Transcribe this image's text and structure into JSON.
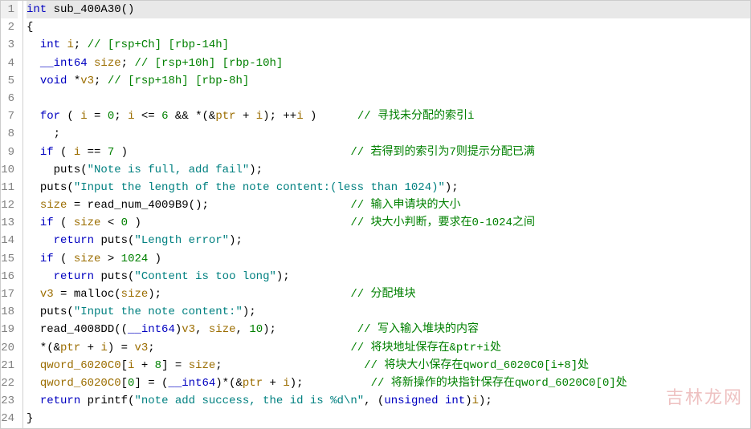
{
  "watermark": "吉林龙网",
  "lines": [
    {
      "n": 1,
      "current": true,
      "tokens": [
        [
          "type",
          "int"
        ],
        [
          "op",
          " "
        ],
        [
          "id-func",
          "sub_400A30"
        ],
        [
          "op",
          "()"
        ]
      ]
    },
    {
      "n": 2,
      "tokens": [
        [
          "braces",
          "{"
        ]
      ]
    },
    {
      "n": 3,
      "tokens": [
        [
          "op",
          "  "
        ],
        [
          "type",
          "int"
        ],
        [
          "op",
          " "
        ],
        [
          "var",
          "i"
        ],
        [
          "op",
          "; "
        ],
        [
          "c",
          "// [rsp+Ch] [rbp-14h]"
        ]
      ]
    },
    {
      "n": 4,
      "tokens": [
        [
          "op",
          "  "
        ],
        [
          "type",
          "__int64"
        ],
        [
          "op",
          " "
        ],
        [
          "var",
          "size"
        ],
        [
          "op",
          "; "
        ],
        [
          "c",
          "// [rsp+10h] [rbp-10h]"
        ]
      ]
    },
    {
      "n": 5,
      "tokens": [
        [
          "op",
          "  "
        ],
        [
          "type",
          "void"
        ],
        [
          "op",
          " *"
        ],
        [
          "var",
          "v3"
        ],
        [
          "op",
          "; "
        ],
        [
          "c",
          "// [rsp+18h] [rbp-8h]"
        ]
      ]
    },
    {
      "n": 6,
      "tokens": [
        [
          "op",
          " "
        ]
      ]
    },
    {
      "n": 7,
      "tokens": [
        [
          "op",
          "  "
        ],
        [
          "kw",
          "for"
        ],
        [
          "op",
          " ( "
        ],
        [
          "var",
          "i"
        ],
        [
          "op",
          " = "
        ],
        [
          "num",
          "0"
        ],
        [
          "op",
          "; "
        ],
        [
          "var",
          "i"
        ],
        [
          "op",
          " <= "
        ],
        [
          "num",
          "6"
        ],
        [
          "op",
          " && *(&"
        ],
        [
          "var",
          "ptr"
        ],
        [
          "op",
          " + "
        ],
        [
          "var",
          "i"
        ],
        [
          "op",
          "); ++"
        ],
        [
          "var",
          "i"
        ],
        [
          "op",
          " )      "
        ],
        [
          "c",
          "// 寻找未分配的索引i"
        ]
      ]
    },
    {
      "n": 8,
      "tokens": [
        [
          "op",
          "    ;"
        ]
      ]
    },
    {
      "n": 9,
      "tokens": [
        [
          "op",
          "  "
        ],
        [
          "kw",
          "if"
        ],
        [
          "op",
          " ( "
        ],
        [
          "var",
          "i"
        ],
        [
          "op",
          " == "
        ],
        [
          "num",
          "7"
        ],
        [
          "op",
          " )                                 "
        ],
        [
          "c",
          "// 若得到的索引为7则提示分配已满"
        ]
      ]
    },
    {
      "n": 10,
      "tokens": [
        [
          "op",
          "    "
        ],
        [
          "id-func",
          "puts"
        ],
        [
          "op",
          "("
        ],
        [
          "s",
          "\"Note is full, add fail\""
        ],
        [
          "op",
          ");"
        ]
      ]
    },
    {
      "n": 11,
      "tokens": [
        [
          "op",
          "  "
        ],
        [
          "id-func",
          "puts"
        ],
        [
          "op",
          "("
        ],
        [
          "s",
          "\"Input the length of the note content:(less than 1024)\""
        ],
        [
          "op",
          ");"
        ]
      ]
    },
    {
      "n": 12,
      "tokens": [
        [
          "op",
          "  "
        ],
        [
          "var",
          "size"
        ],
        [
          "op",
          " = "
        ],
        [
          "id-func",
          "read_num_4009B9"
        ],
        [
          "op",
          "();                     "
        ],
        [
          "c",
          "// 输入申请块的大小"
        ]
      ]
    },
    {
      "n": 13,
      "tokens": [
        [
          "op",
          "  "
        ],
        [
          "kw",
          "if"
        ],
        [
          "op",
          " ( "
        ],
        [
          "var",
          "size"
        ],
        [
          "op",
          " < "
        ],
        [
          "num",
          "0"
        ],
        [
          "op",
          " )                               "
        ],
        [
          "c",
          "// 块大小判断，要求在0-1024之间"
        ]
      ]
    },
    {
      "n": 14,
      "tokens": [
        [
          "op",
          "    "
        ],
        [
          "kw",
          "return"
        ],
        [
          "op",
          " "
        ],
        [
          "id-func",
          "puts"
        ],
        [
          "op",
          "("
        ],
        [
          "s",
          "\"Length error\""
        ],
        [
          "op",
          ");"
        ]
      ]
    },
    {
      "n": 15,
      "tokens": [
        [
          "op",
          "  "
        ],
        [
          "kw",
          "if"
        ],
        [
          "op",
          " ( "
        ],
        [
          "var",
          "size"
        ],
        [
          "op",
          " > "
        ],
        [
          "num",
          "1024"
        ],
        [
          "op",
          " )"
        ]
      ]
    },
    {
      "n": 16,
      "tokens": [
        [
          "op",
          "    "
        ],
        [
          "kw",
          "return"
        ],
        [
          "op",
          " "
        ],
        [
          "id-func",
          "puts"
        ],
        [
          "op",
          "("
        ],
        [
          "s",
          "\"Content is too long\""
        ],
        [
          "op",
          ");"
        ]
      ]
    },
    {
      "n": 17,
      "tokens": [
        [
          "op",
          "  "
        ],
        [
          "var",
          "v3"
        ],
        [
          "op",
          " = "
        ],
        [
          "id-func",
          "malloc"
        ],
        [
          "op",
          "("
        ],
        [
          "var",
          "size"
        ],
        [
          "op",
          ");                            "
        ],
        [
          "c",
          "// 分配堆块"
        ]
      ]
    },
    {
      "n": 18,
      "tokens": [
        [
          "op",
          "  "
        ],
        [
          "id-func",
          "puts"
        ],
        [
          "op",
          "("
        ],
        [
          "s",
          "\"Input the note content:\""
        ],
        [
          "op",
          ");"
        ]
      ]
    },
    {
      "n": 19,
      "tokens": [
        [
          "op",
          "  "
        ],
        [
          "id-func",
          "read_4008DD"
        ],
        [
          "op",
          "(("
        ],
        [
          "type",
          "__int64"
        ],
        [
          "op",
          ")"
        ],
        [
          "var",
          "v3"
        ],
        [
          "op",
          ", "
        ],
        [
          "var",
          "size"
        ],
        [
          "op",
          ", "
        ],
        [
          "num",
          "10"
        ],
        [
          "op",
          ");            "
        ],
        [
          "c",
          "// 写入输入堆块的内容"
        ]
      ]
    },
    {
      "n": 20,
      "tokens": [
        [
          "op",
          "  *(&"
        ],
        [
          "var",
          "ptr"
        ],
        [
          "op",
          " + "
        ],
        [
          "var",
          "i"
        ],
        [
          "op",
          ") = "
        ],
        [
          "var",
          "v3"
        ],
        [
          "op",
          ";                             "
        ],
        [
          "c",
          "// 将块地址保存在&ptr+i处"
        ]
      ]
    },
    {
      "n": 21,
      "tokens": [
        [
          "op",
          "  "
        ],
        [
          "var",
          "qword_6020C0"
        ],
        [
          "op",
          "["
        ],
        [
          "var",
          "i"
        ],
        [
          "op",
          " + "
        ],
        [
          "num",
          "8"
        ],
        [
          "op",
          "] = "
        ],
        [
          "var",
          "size"
        ],
        [
          "op",
          ";                     "
        ],
        [
          "c",
          "// 将块大小保存在qword_6020C0[i+8]处"
        ]
      ]
    },
    {
      "n": 22,
      "tokens": [
        [
          "op",
          "  "
        ],
        [
          "var",
          "qword_6020C0"
        ],
        [
          "op",
          "["
        ],
        [
          "num",
          "0"
        ],
        [
          "op",
          "] = ("
        ],
        [
          "type",
          "__int64"
        ],
        [
          "op",
          ")*(&"
        ],
        [
          "var",
          "ptr"
        ],
        [
          "op",
          " + "
        ],
        [
          "var",
          "i"
        ],
        [
          "op",
          ");          "
        ],
        [
          "c",
          "// 将新操作的块指针保存在qword_6020C0[0]处"
        ]
      ]
    },
    {
      "n": 23,
      "tokens": [
        [
          "op",
          "  "
        ],
        [
          "kw",
          "return"
        ],
        [
          "op",
          " "
        ],
        [
          "id-func",
          "printf"
        ],
        [
          "op",
          "("
        ],
        [
          "s",
          "\"note add success, the id is %d\\n\""
        ],
        [
          "op",
          ", ("
        ],
        [
          "type",
          "unsigned"
        ],
        [
          "op",
          " "
        ],
        [
          "type",
          "int"
        ],
        [
          "op",
          ")"
        ],
        [
          "var",
          "i"
        ],
        [
          "op",
          ");"
        ]
      ]
    },
    {
      "n": 24,
      "tokens": [
        [
          "braces",
          "}"
        ]
      ]
    }
  ]
}
